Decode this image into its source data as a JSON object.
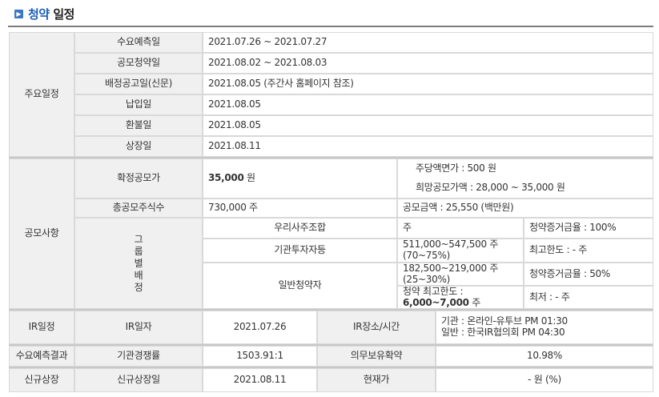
{
  "header": {
    "title_part1": "청약",
    "title_part2": "일정"
  },
  "schedule": {
    "section": "주요일정",
    "rows": [
      {
        "label": "수요예측일",
        "value": "2021.07.26 ~ 2021.07.27"
      },
      {
        "label": "공모청약일",
        "value": "2021.08.02 ~ 2021.08.03"
      },
      {
        "label": "배정공고일(신문)",
        "value": "2021.08.05 (주간사 홈페이지 참조)"
      },
      {
        "label": "납입일",
        "value": "2021.08.05"
      },
      {
        "label": "환불일",
        "value": "2021.08.05"
      },
      {
        "label": "상장일",
        "value": "2021.08.11"
      }
    ]
  },
  "offering": {
    "section": "공모사항",
    "confirmed_price_label": "확정공모가",
    "confirmed_price_value": "35,000",
    "confirmed_price_unit": "원",
    "par_value": "주당액면가 :  500 원",
    "desired_price": "희망공모가액 :  28,000 ~ 35,000 원",
    "total_shares_label": "총공모주식수",
    "total_shares_value": "730,000 주",
    "offering_amount": "공모금액 : 25,550 (백만원)",
    "group_label": [
      "그",
      "룹",
      "별",
      "배",
      "정"
    ],
    "employees_label": "우리사주조합",
    "employees_value": "주",
    "employees_margin": "청약증거금율 : 100%",
    "institutions_label": "기관투자자등",
    "institutions_value_line1": "511,000~547,500 주",
    "institutions_value_line2": "(70~75%)",
    "institutions_max": "최고한도 :  - 주",
    "general_label": "일반청약자",
    "general_value_line1": "182,500~219,000 주",
    "general_value_line2": "(25~30%)",
    "general_margin": "청약증거금율 : 50%",
    "general_max_label": "청약 최고한도 :",
    "general_max_value": "6,000~7,000",
    "general_max_unit": "주",
    "general_min": "최저 :  - 주"
  },
  "ir": {
    "section": "IR일정",
    "date_label": "IR일자",
    "date_value": "2021.07.26",
    "place_label": "IR장소/시간",
    "place_line1": "기관 : 온라인-유투브 PM 01:30",
    "place_line2": "일반 : 한국IR협의회 PM 04:30"
  },
  "demand": {
    "section": "수요예측결과",
    "competition_label": "기관경쟁률",
    "competition_value": "1503.91:1",
    "lockup_label": "의무보유확약",
    "lockup_value": "10.98%"
  },
  "listing": {
    "section": "신규상장",
    "date_label": "신규상장일",
    "date_value": "2021.08.11",
    "current_label": "현재가",
    "current_value": "- 원 (%)"
  }
}
